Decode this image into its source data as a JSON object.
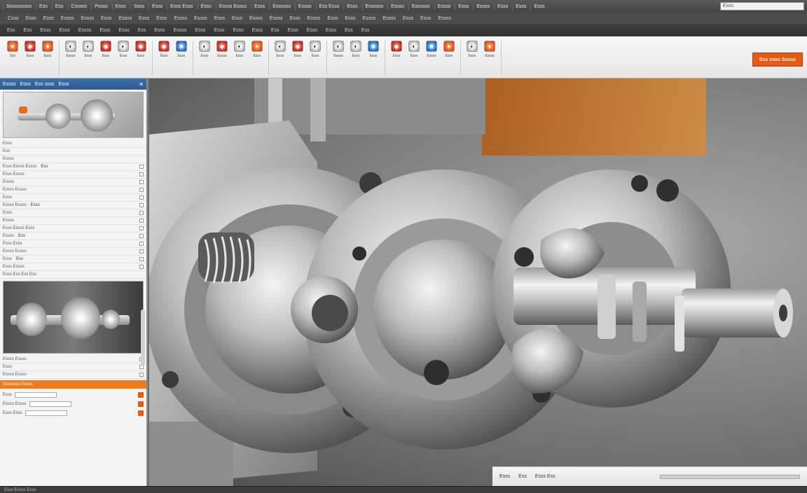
{
  "menubar": {
    "items": [
      "Ssssssssss",
      "Ess",
      "Ess",
      "Csssss",
      "Pssss",
      "Esss",
      "Ssss",
      "Esss",
      "Esss Esss",
      "Esss",
      "Essss Essss",
      "Esss",
      "Essssss",
      "Essss",
      "Ess Esss",
      "Esss",
      "Essssss",
      "Essss",
      "Essssss",
      "Essss",
      "Esss",
      "Essss",
      "Esss",
      "Esss",
      "Esss"
    ],
    "search_text": "Esss"
  },
  "subbar": {
    "items": [
      "Csss",
      "Esss",
      "Esss",
      "Essss",
      "Essss",
      "Esss",
      "Essss",
      "Esss",
      "Esss",
      "Essss",
      "Essss",
      "Esss",
      "Esss",
      "Essss",
      "Essss",
      "Esss",
      "Essss",
      "Esss",
      "Esss",
      "Essss",
      "Essss",
      "Esss",
      "Esss",
      "Essss"
    ]
  },
  "strip3": {
    "items": [
      "Ess",
      "Ess",
      "Esss",
      "Esss",
      "Essss",
      "Esss",
      "Esss",
      "Ess",
      "Esss",
      "Essss",
      "Esss",
      "Esss",
      "Esss",
      "Esss",
      "Ess",
      "Esss",
      "Esss",
      "Esss",
      "Ess",
      "Ess"
    ]
  },
  "ribbon": {
    "groups": [
      {
        "buttons": [
          {
            "icon": "part-icon",
            "label": "Sss",
            "tone": "orange"
          },
          {
            "icon": "assembly-icon",
            "label": "Esss",
            "tone": "red"
          },
          {
            "icon": "sketch-icon",
            "label": "Esss",
            "tone": "orange"
          }
        ]
      },
      {
        "buttons": [
          {
            "icon": "extrude-icon",
            "label": "Essss",
            "tone": "grey"
          },
          {
            "icon": "revolve-icon",
            "label": "Esss",
            "tone": "grey"
          },
          {
            "icon": "hole-icon",
            "label": "Esss",
            "tone": "red"
          },
          {
            "icon": "fillet-icon",
            "label": "Esss",
            "tone": "grey"
          },
          {
            "icon": "chamfer-icon",
            "label": "Esss",
            "tone": "red"
          }
        ]
      },
      {
        "buttons": [
          {
            "icon": "mirror-icon",
            "label": "Esss",
            "tone": "red"
          },
          {
            "icon": "pattern-icon",
            "label": "Esss",
            "tone": "blue"
          }
        ]
      },
      {
        "buttons": [
          {
            "icon": "measure-icon",
            "label": "Esss",
            "tone": "grey"
          },
          {
            "icon": "section-icon",
            "label": "Essss",
            "tone": "red"
          },
          {
            "icon": "view-icon",
            "label": "Esss",
            "tone": "grey"
          },
          {
            "icon": "render-icon",
            "label": "Esss",
            "tone": "orange"
          }
        ]
      },
      {
        "buttons": [
          {
            "icon": "material-icon",
            "label": "Esss",
            "tone": "grey"
          },
          {
            "icon": "mate-icon",
            "label": "Esss",
            "tone": "red"
          },
          {
            "icon": "explode-icon",
            "label": "Esss",
            "tone": "grey"
          }
        ]
      },
      {
        "buttons": [
          {
            "icon": "drawing-icon",
            "label": "Essss",
            "tone": "grey"
          },
          {
            "icon": "simulate-icon",
            "label": "Esss",
            "tone": "grey"
          },
          {
            "icon": "motion-icon",
            "label": "Esss",
            "tone": "blue"
          }
        ]
      },
      {
        "buttons": [
          {
            "icon": "export-icon",
            "label": "Esss",
            "tone": "red"
          },
          {
            "icon": "print-icon",
            "label": "Esss",
            "tone": "grey"
          },
          {
            "icon": "settings-icon",
            "label": "Essss",
            "tone": "blue"
          },
          {
            "icon": "help-icon",
            "label": "Esss",
            "tone": "orange"
          }
        ]
      },
      {
        "buttons": [
          {
            "icon": "camera-icon",
            "label": "Esss",
            "tone": "grey"
          },
          {
            "icon": "light-icon",
            "label": "Essss",
            "tone": "orange"
          }
        ]
      }
    ],
    "cta_label": "Sss ssss Sssss"
  },
  "leftpanel": {
    "header": [
      "Essss",
      "Esss",
      "Ess ssss",
      "Esss"
    ],
    "top_rows": [
      "Esss",
      "Ess",
      "Essss"
    ],
    "rows": [
      {
        "label": "Esss Essss Essss",
        "value": "Ess"
      },
      {
        "label": "Esss Essss",
        "value": ""
      },
      {
        "label": "Essss",
        "value": ""
      },
      {
        "label": "Essss Essss",
        "value": ""
      },
      {
        "label": "Esss",
        "value": ""
      },
      {
        "label": "Essss Essss",
        "value": "Esss"
      },
      {
        "label": "Esss",
        "value": ""
      },
      {
        "label": "Essss",
        "value": ""
      },
      {
        "label": "Esss Essss Esss",
        "value": ""
      },
      {
        "label": "Essss",
        "value": "Ess"
      },
      {
        "label": "Esss Esss",
        "value": ""
      },
      {
        "label": "Essss Essss",
        "value": ""
      },
      {
        "label": "Esss",
        "value": "Ess"
      },
      {
        "label": "Esss Essss",
        "value": ""
      }
    ],
    "mid_header": "Esss Ess Ess  Ess",
    "bottom_rows": [
      {
        "label": "Essss Essss",
        "value": ""
      },
      {
        "label": "Esss",
        "value": ""
      },
      {
        "label": "Essss Essss",
        "value": ""
      }
    ],
    "orange_row": "Esssssss Essss",
    "fields": [
      {
        "label": "Esss"
      },
      {
        "label": "Essss Essss"
      },
      {
        "label": "Esss Esss"
      }
    ]
  },
  "viewport": {
    "bottom_labels": [
      "Esss",
      "Ess",
      "Esss Ess"
    ],
    "colors": {
      "steel_light": "#f2f2f2",
      "steel_mid": "#b4b4b4",
      "steel_dark": "#5c5c5c",
      "accent": "#e85a14"
    }
  },
  "statusbar": {
    "text": "Esss Essss Esss"
  }
}
